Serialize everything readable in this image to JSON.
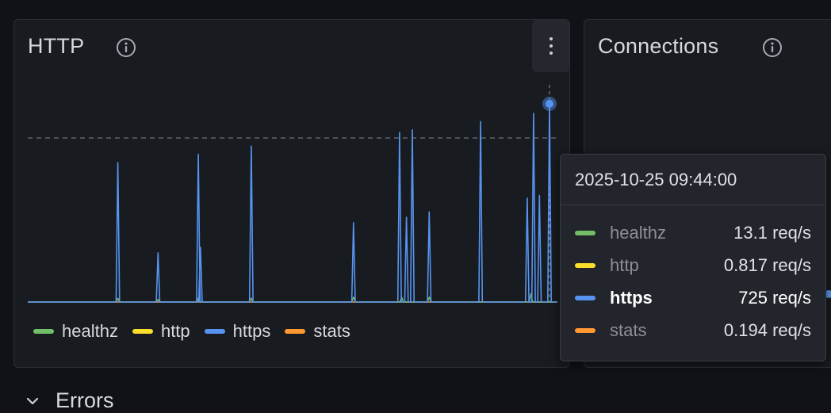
{
  "http_panel": {
    "title": "HTTP",
    "info_icon": "info-icon",
    "menu_icon": "kebab-menu-icon",
    "legend": [
      {
        "name": "healthz",
        "color": "#73bf69"
      },
      {
        "name": "http",
        "color": "#fade2a"
      },
      {
        "name": "https",
        "color": "#5794f2"
      },
      {
        "name": "stats",
        "color": "#ff9830"
      }
    ]
  },
  "connections_panel": {
    "title": "Connections",
    "info_icon": "info-icon"
  },
  "tooltip": {
    "time": "2025-10-25 09:44:00",
    "rows": [
      {
        "name": "healthz",
        "value": "13.1 req/s",
        "color": "#73bf69",
        "active": false
      },
      {
        "name": "http",
        "value": "0.817 req/s",
        "color": "#fade2a",
        "active": false
      },
      {
        "name": "https",
        "value": "725 req/s",
        "color": "#5794f2",
        "active": true
      },
      {
        "name": "stats",
        "value": "0.194 req/s",
        "color": "#ff9830",
        "active": false
      }
    ]
  },
  "errors_section": {
    "title": "Errors",
    "chevron_icon": "chevron-down-icon"
  },
  "chart_data": {
    "type": "line",
    "x_range": [
      0,
      100
    ],
    "ylim": [
      0,
      800
    ],
    "threshold": 600,
    "hover_x": 98.5,
    "series": [
      {
        "name": "https",
        "color": "#5794f2",
        "spikes": [
          {
            "x": 17.0,
            "y": 510
          },
          {
            "x": 24.6,
            "y": 180
          },
          {
            "x": 32.2,
            "y": 540
          },
          {
            "x": 32.6,
            "y": 200
          },
          {
            "x": 42.2,
            "y": 570
          },
          {
            "x": 61.5,
            "y": 290
          },
          {
            "x": 70.2,
            "y": 620
          },
          {
            "x": 71.5,
            "y": 310
          },
          {
            "x": 72.6,
            "y": 630
          },
          {
            "x": 75.8,
            "y": 330
          },
          {
            "x": 85.5,
            "y": 660
          },
          {
            "x": 94.3,
            "y": 380
          },
          {
            "x": 95.5,
            "y": 690
          },
          {
            "x": 96.6,
            "y": 390
          },
          {
            "x": 98.5,
            "y": 725
          }
        ]
      },
      {
        "name": "healthz",
        "color": "#73bf69",
        "spikes": [
          {
            "x": 17.0,
            "y": 14
          },
          {
            "x": 24.6,
            "y": 10
          },
          {
            "x": 32.2,
            "y": 14
          },
          {
            "x": 42.2,
            "y": 14
          },
          {
            "x": 61.5,
            "y": 18
          },
          {
            "x": 70.6,
            "y": 18
          },
          {
            "x": 75.8,
            "y": 18
          },
          {
            "x": 95.0,
            "y": 30
          }
        ]
      },
      {
        "name": "http",
        "color": "#fade2a",
        "spikes": []
      },
      {
        "name": "stats",
        "color": "#ff9830",
        "spikes": []
      }
    ]
  }
}
